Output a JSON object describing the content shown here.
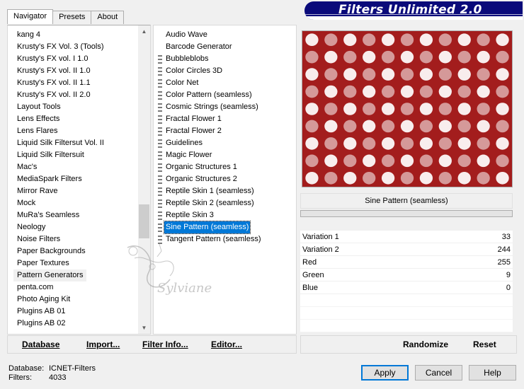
{
  "banner_title": "Filters Unlimited 2.0",
  "tabs": [
    {
      "label": "Navigator",
      "active": true
    },
    {
      "label": "Presets",
      "active": false
    },
    {
      "label": "About",
      "active": false
    }
  ],
  "categories": [
    "kang 4",
    "Krusty's FX Vol. 3 (Tools)",
    "Krusty's FX vol. I 1.0",
    "Krusty's FX vol. II 1.0",
    "Krusty's FX vol. II 1.1",
    "Krusty's FX vol. II 2.0",
    "Layout Tools",
    "Lens Effects",
    "Lens Flares",
    "Liquid Silk Filtersut Vol. II",
    "Liquid Silk Filtersuit",
    "Mac's",
    "MediaSpark Filters",
    "Mirror Rave",
    "Mock",
    "MuRa's Seamless",
    "Neology",
    "Noise Filters",
    "Paper Backgrounds",
    "Paper Textures",
    "Pattern Generators",
    "penta.com",
    "Photo Aging Kit",
    "Plugins AB 01",
    "Plugins AB 02"
  ],
  "selected_category": "Pattern Generators",
  "filters": [
    {
      "name": "Audio Wave",
      "icon": false
    },
    {
      "name": "Barcode Generator",
      "icon": false
    },
    {
      "name": "Bubbleblobs",
      "icon": true
    },
    {
      "name": "Color Circles 3D",
      "icon": true
    },
    {
      "name": "Color Net",
      "icon": true
    },
    {
      "name": "Color Pattern (seamless)",
      "icon": true
    },
    {
      "name": "Cosmic Strings (seamless)",
      "icon": true
    },
    {
      "name": "Fractal Flower 1",
      "icon": true
    },
    {
      "name": "Fractal Flower 2",
      "icon": true
    },
    {
      "name": "Guidelines",
      "icon": true
    },
    {
      "name": "Magic Flower",
      "icon": true
    },
    {
      "name": "Organic Structures 1",
      "icon": true
    },
    {
      "name": "Organic Structures 2",
      "icon": true
    },
    {
      "name": "Reptile Skin 1 (seamless)",
      "icon": true
    },
    {
      "name": "Reptile Skin 2 (seamless)",
      "icon": true
    },
    {
      "name": "Reptile Skin 3",
      "icon": true
    },
    {
      "name": "Sine Pattern (seamless)",
      "icon": true,
      "selected": true
    },
    {
      "name": "Tangent Pattern (seamless)",
      "icon": true
    }
  ],
  "preview": {
    "pattern_color": "#a31d1d",
    "highlight_color": "#ffffff"
  },
  "current_filter": "Sine Pattern (seamless)",
  "params": [
    {
      "label": "Variation 1",
      "value": "33"
    },
    {
      "label": "Variation 2",
      "value": "244"
    },
    {
      "label": "Red",
      "value": "255"
    },
    {
      "label": "Green",
      "value": "9"
    },
    {
      "label": "Blue",
      "value": "0"
    }
  ],
  "left_buttons": {
    "database": "Database",
    "import": "Import...",
    "filter_info": "Filter Info...",
    "editor": "Editor..."
  },
  "right_buttons": {
    "randomize": "Randomize",
    "reset": "Reset"
  },
  "status": {
    "database_label": "Database:",
    "database_value": "ICNET-Filters",
    "filters_label": "Filters:",
    "filters_value": "4033"
  },
  "dialog_buttons": {
    "apply": "Apply",
    "cancel": "Cancel",
    "help": "Help"
  },
  "watermark": "Sylviane",
  "colors": {
    "banner": "#0a0a7a",
    "selection": "#0078d7"
  }
}
